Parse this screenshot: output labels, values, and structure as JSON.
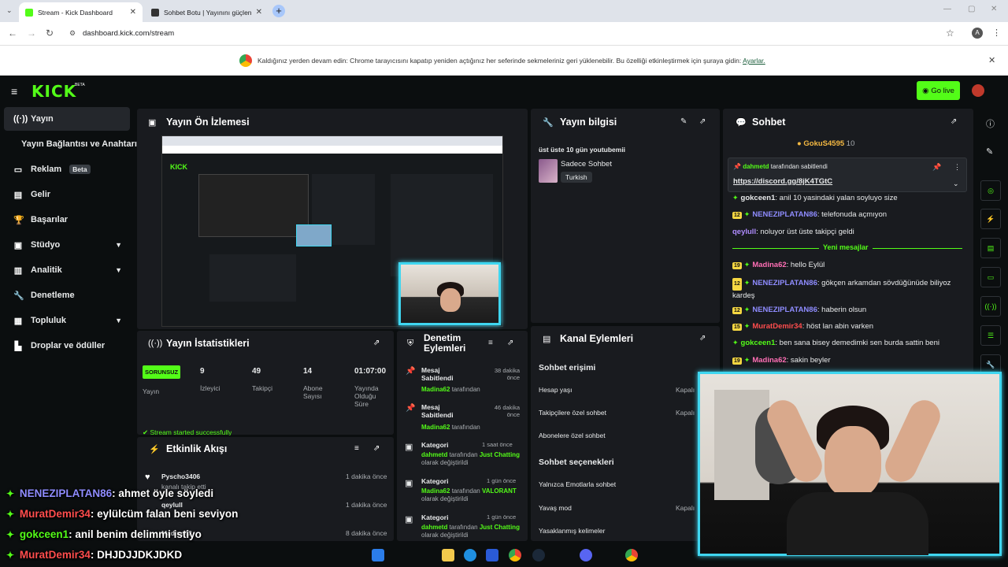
{
  "browser": {
    "tabs": [
      {
        "label": "Stream - Kick Dashboard"
      },
      {
        "label": "Sohbet Botu | Yayınını güçlendi"
      }
    ],
    "url": "dashboard.kick.com/stream",
    "notification": {
      "text": "Kaldığınız yerden devam edin: Chrome tarayıcısını kapatıp yeniden açtığınız her seferinde sekmeleriniz geri yüklenebilir. Bu özelliği etkinleştirmek için şuraya gidin:",
      "link": "Ayarlar."
    },
    "profile_initial": "A"
  },
  "header": {
    "logo": "KICK",
    "logo_beta": "BETA",
    "go_live": "Go live"
  },
  "sidebar": {
    "items": [
      {
        "label": "Yayın",
        "icon": "broadcast-icon"
      },
      {
        "label": "Yayın Bağlantısı ve Anahtarı"
      },
      {
        "label": "Reklam",
        "badge": "Beta",
        "icon": "ad-icon"
      },
      {
        "label": "Gelir",
        "icon": "revenue-icon"
      },
      {
        "label": "Başarılar",
        "icon": "trophy-icon"
      },
      {
        "label": "Stüdyo",
        "icon": "studio-icon"
      },
      {
        "label": "Analitik",
        "icon": "analytics-icon"
      },
      {
        "label": "Denetleme",
        "icon": "wrench-icon"
      },
      {
        "label": "Topluluk",
        "icon": "community-icon"
      },
      {
        "label": "Droplar ve ödüller",
        "icon": "drops-icon"
      }
    ]
  },
  "preview": {
    "title": "Yayın Ön İzlemesi"
  },
  "stats": {
    "title": "Yayın İstatistikleri",
    "status": "SORUNSUZ",
    "status_label": "Yayın",
    "items": [
      {
        "value": "9",
        "label": "İzleyici"
      },
      {
        "value": "49",
        "label": "Takipçi"
      },
      {
        "value": "14",
        "label": "Abone Sayısı"
      },
      {
        "value": "01:07:00",
        "label": "Yayında Olduğu Süre"
      }
    ],
    "toast": "Stream started successfully"
  },
  "activity": {
    "title": "Etkinlik Akışı",
    "items": [
      {
        "name": "Pyscho3406",
        "sub": "kanalı takip etti",
        "time": "1 dakika önce"
      },
      {
        "name": "qeylull",
        "sub": "",
        "time": "1 dakika önce"
      },
      {
        "name": "Madina62",
        "sub": "",
        "time": "8 dakika önce"
      }
    ]
  },
  "moderation": {
    "title_line1": "Denetim",
    "title_line2": "Eylemleri",
    "items": [
      {
        "title": "Mesaj Sabitlendi",
        "user": "Madina62",
        "suffix": "tarafından",
        "time": "38 dakika önce"
      },
      {
        "title": "Mesaj Sabitlendi",
        "user": "Madina62",
        "suffix": "tarafından",
        "time": "46 dakika önce"
      },
      {
        "title": "Kategori",
        "user": "dahmetd",
        "suffix": "tarafından",
        "value": "Just Chatting",
        "tail": "olarak değiştirildi",
        "time": "1 saat önce"
      },
      {
        "title": "Kategori",
        "user": "Madina62",
        "suffix": "tarafından",
        "value": "VALORANT",
        "tail": "olarak değiştirildi",
        "time": "1 gün önce"
      },
      {
        "title": "Kategori",
        "user": "dahmetd",
        "suffix": "tarafından",
        "value": "Just Chatting",
        "tail": "olarak değiştirildi",
        "time": "1 gün önce"
      }
    ]
  },
  "info": {
    "title": "Yayın bilgisi",
    "stream_title": "üst üste 10 gün youtubemii",
    "category": "Sadece Sohbet",
    "language": "Turkish"
  },
  "channel_actions": {
    "title": "Kanal Eylemleri",
    "section1": "Sohbet erişimi",
    "rows1": [
      {
        "label": "Hesap yaşı",
        "value": "Kapalı"
      },
      {
        "label": "Takipçilere özel sohbet",
        "value": "Kapalı"
      },
      {
        "label": "Abonelere özel sohbet",
        "value": ""
      }
    ],
    "section2": "Sohbet seçenekleri",
    "rows2": [
      {
        "label": "Yalnızca Emotlarla sohbet",
        "value": ""
      },
      {
        "label": "Yavaş mod",
        "value": "Kapalı"
      },
      {
        "label": "Yasaklanmış kelimeler",
        "value": ""
      }
    ]
  },
  "chat": {
    "title": "Sohbet",
    "top_user": "GokuS4595",
    "top_count": "10",
    "pinned": {
      "by": "dahmetd",
      "suffix": "tarafından sabitlendi",
      "text": "https://discord.gg/8jK4TGtC"
    },
    "messages": [
      {
        "user": "gokceen1",
        "color": "#53fc18",
        "text": "anil 10 yasindaki yalan soyluyo size",
        "lvl": ""
      },
      {
        "user": "NENEZIPLATAN86",
        "color": "#8f8cff",
        "text": "telefonuda açmıyon",
        "lvl": "12"
      },
      {
        "user": "qeylull",
        "color": "#b08cff",
        "text": "noluyor üst üste takipçi geldi",
        "lvl": ""
      }
    ],
    "new_messages": "Yeni mesajlar",
    "messages2": [
      {
        "user": "Madina62",
        "color": "#ff6fb5",
        "text": "hello Eylül",
        "lvl": "19"
      },
      {
        "user": "NENEZIPLATAN86",
        "color": "#8f8cff",
        "text": "gökçen arkamdan sövdüğünüde biliyoz kardeş",
        "lvl": "12"
      },
      {
        "user": "NENEZIPLATAN86",
        "color": "#8f8cff",
        "text": "haberin olsun",
        "lvl": "12"
      },
      {
        "user": "MuratDemir34",
        "color": "#ff4d4d",
        "text": "höst lan abin varken",
        "lvl": "15"
      },
      {
        "user": "gokceen1",
        "color": "#53fc18",
        "text": "ben sana bisey demedimki sen burda sattin beni",
        "lvl": ""
      },
      {
        "user": "Madina62",
        "color": "#ff6fb5",
        "text": "sakin beyler",
        "lvl": "19"
      }
    ]
  },
  "overlay_chat": [
    {
      "user": "NENEZIPLATAN86",
      "color": "#8f8cff",
      "text": ": ahmet öyle söyledi"
    },
    {
      "user": "MuratDemir34",
      "color": "#ff4d4d",
      "text": ": eylülcüm falan beni seviyon"
    },
    {
      "user": "gokceen1",
      "color": "#53fc18",
      "text": ": anil benim delimmi istiyo"
    },
    {
      "user": "MuratDemir34",
      "color": "#ff4d4d",
      "text": ": DHJDJJDKJDKD"
    }
  ]
}
